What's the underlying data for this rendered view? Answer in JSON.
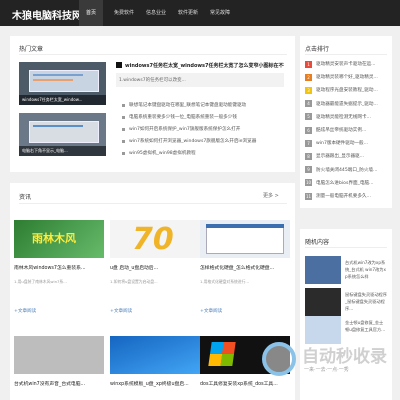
{
  "header": {
    "logo": "木狼电脑科技网",
    "nav": [
      "首页",
      "免费软件",
      "信息业业",
      "软件更新",
      "常见故障"
    ]
  },
  "hot": {
    "title": "热门文章",
    "thumb_captions": [
      "windows7任务栏太宽_window...",
      "电脑右下角不显示_电脑..."
    ],
    "headline": "windows7任务栏太宽_windows7任务栏太宽了怎么变窄小图标在不行",
    "headline_desc": "1.windows7的任务栏可以改变...",
    "list": [
      "联想笔记本键盘驱动在哪里_联想笔记本键盘驱动能键驱动",
      "电脑系统重装要多少钱一位_电脑系统重装一般多少钱",
      "win7如何开启系统保护_win7旗舰版系统保护怎么打开",
      "win7系统如何打开浏览器_windows7旗舰版怎么开启ie浏览器",
      "win95虚拟机_win98虚拟机教程"
    ]
  },
  "latest": {
    "title": "资讯",
    "more": "更多 >",
    "cards": [
      {
        "title": "南林木风windows7怎么重装系...",
        "desc": "1.用u盘装了南林木风win7系...",
        "more": "+文章阅读",
        "img_text": "雨林木风"
      },
      {
        "title": "u盘 启动_u盘启动后...",
        "desc": "1.如何将u盘设置为启动盘...",
        "more": "+文章阅读",
        "img_text": "70"
      },
      {
        "title": "怎样格式化硬盘_怎么格式化硬盘...",
        "desc": "1.用格式化硬盘对系统进行...",
        "more": "+文章阅读",
        "img_text": ""
      },
      {
        "title": "",
        "desc": "",
        "more": "",
        "img_text": "雨林木风"
      },
      {
        "title": "台式机win7没有声音_台式电脑...",
        "desc": "",
        "more": "",
        "img_text": ""
      },
      {
        "title": "winxp系统模板_u盘_xp终极u盘启...",
        "desc": "",
        "more": "",
        "img_text": ""
      },
      {
        "title": "dos工具修复安装xp系统_dos工具...",
        "desc": "",
        "more": "",
        "img_text": ""
      }
    ]
  },
  "sidebar": {
    "rank_title": "点击排行",
    "rank": [
      "驱动精灵安装声卡驱动在运...",
      "驱动精灵装哪个好_驱动精灵...",
      "驱动程序光盘安装教程_驱动...",
      "驱动器最能遗失据提示_驱动...",
      "驱动精灵能检测无线网卡...",
      "酷炫吊丝帝统驱动实例...",
      "win7版本硬件驱动一般...",
      "显示器跟出_显示器驱...",
      "防火墙关闭445端口_防火墙...",
      "电脑怎么进bios界面_电脑...",
      "测量一般电脑开机要多久..."
    ],
    "rank_colors": [
      "#e74c3c",
      "#e67e22",
      "#f1c40f",
      "#999999",
      "#999999",
      "#999999",
      "#999999",
      "#999999",
      "#999999",
      "#999999",
      "#999999"
    ],
    "rand_title": "随机内容",
    "rand": [
      "台式机win7改为xp系统_台式机 win7改为xp系统怎么样",
      "鼠标键盘失灵驱动程序_鼠标键盘失灵驱动程序...",
      "金士顿u盘修复_金士顿u盘修复工具官方...",
      ""
    ]
  },
  "watermark": {
    "text": "自动秒收录",
    "sub": "一来·一去·一点·一秀"
  }
}
